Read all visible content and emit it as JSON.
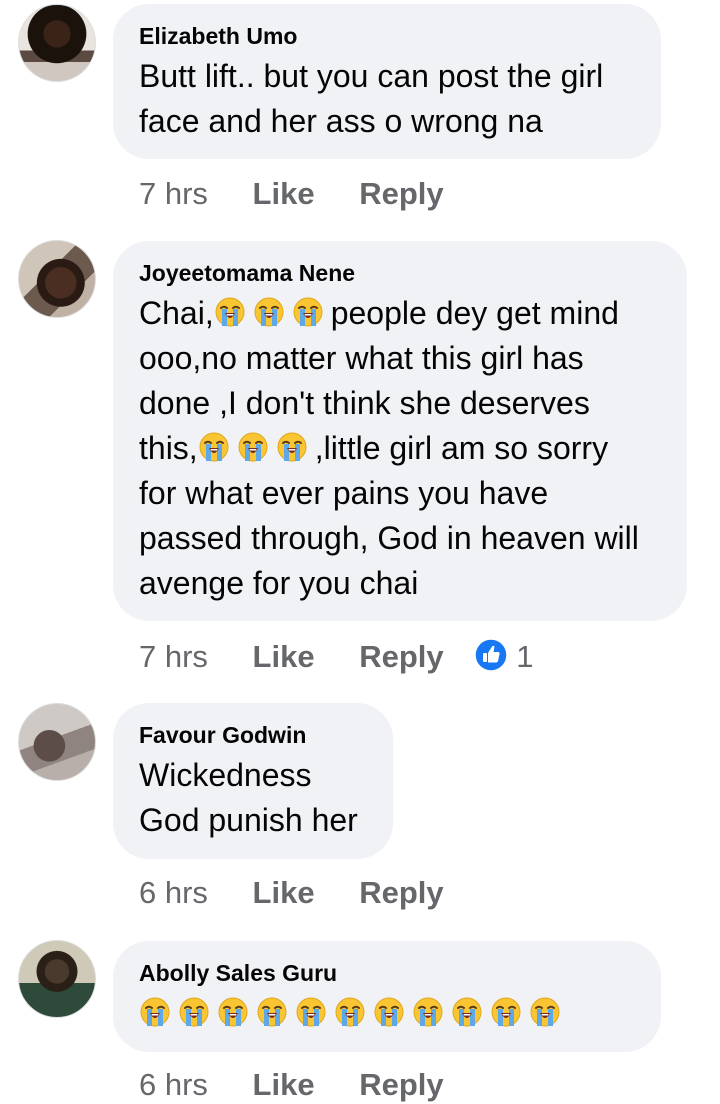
{
  "comments": [
    {
      "author": "Elizabeth Umo",
      "lines": [
        "Butt lift.. but you can post the girl",
        "face and her ass o wrong na"
      ],
      "time": "7 hrs",
      "like_label": "Like",
      "reply_label": "Reply"
    },
    {
      "author": "Joyeetomama Nene",
      "line1_prefix": "Chai,",
      "line1_suffix": "people dey get mind",
      "line2": "ooo,no matter what this girl has",
      "line3": "done ,I don't think she deserves",
      "line4_prefix": "this,",
      "line4_suffix": ",little girl am so sorry",
      "line5": "for what ever pains you have",
      "line6": "passed through, God in heaven will",
      "line7": "avenge for you chai",
      "time": "7 hrs",
      "like_label": "Like",
      "reply_label": "Reply",
      "reaction_count": "1"
    },
    {
      "author": "Favour Godwin",
      "lines": [
        "Wickedness",
        "God punish her"
      ],
      "time": "6 hrs",
      "like_label": "Like",
      "reply_label": "Reply"
    },
    {
      "author": "Abolly Sales Guru",
      "emoji_count": 11,
      "time": "6 hrs",
      "like_label": "Like",
      "reply_label": "Reply"
    }
  ],
  "icons": {
    "crying_emoji": "loudly-crying-face-icon",
    "like_reaction": "thumbs-up-icon"
  },
  "colors": {
    "bubble": "#f0f2f5",
    "meta_text": "#65676b",
    "like_blue": "#1877f2",
    "emoji_yellow": "#f9c532",
    "tears": "#5fa8e8"
  }
}
